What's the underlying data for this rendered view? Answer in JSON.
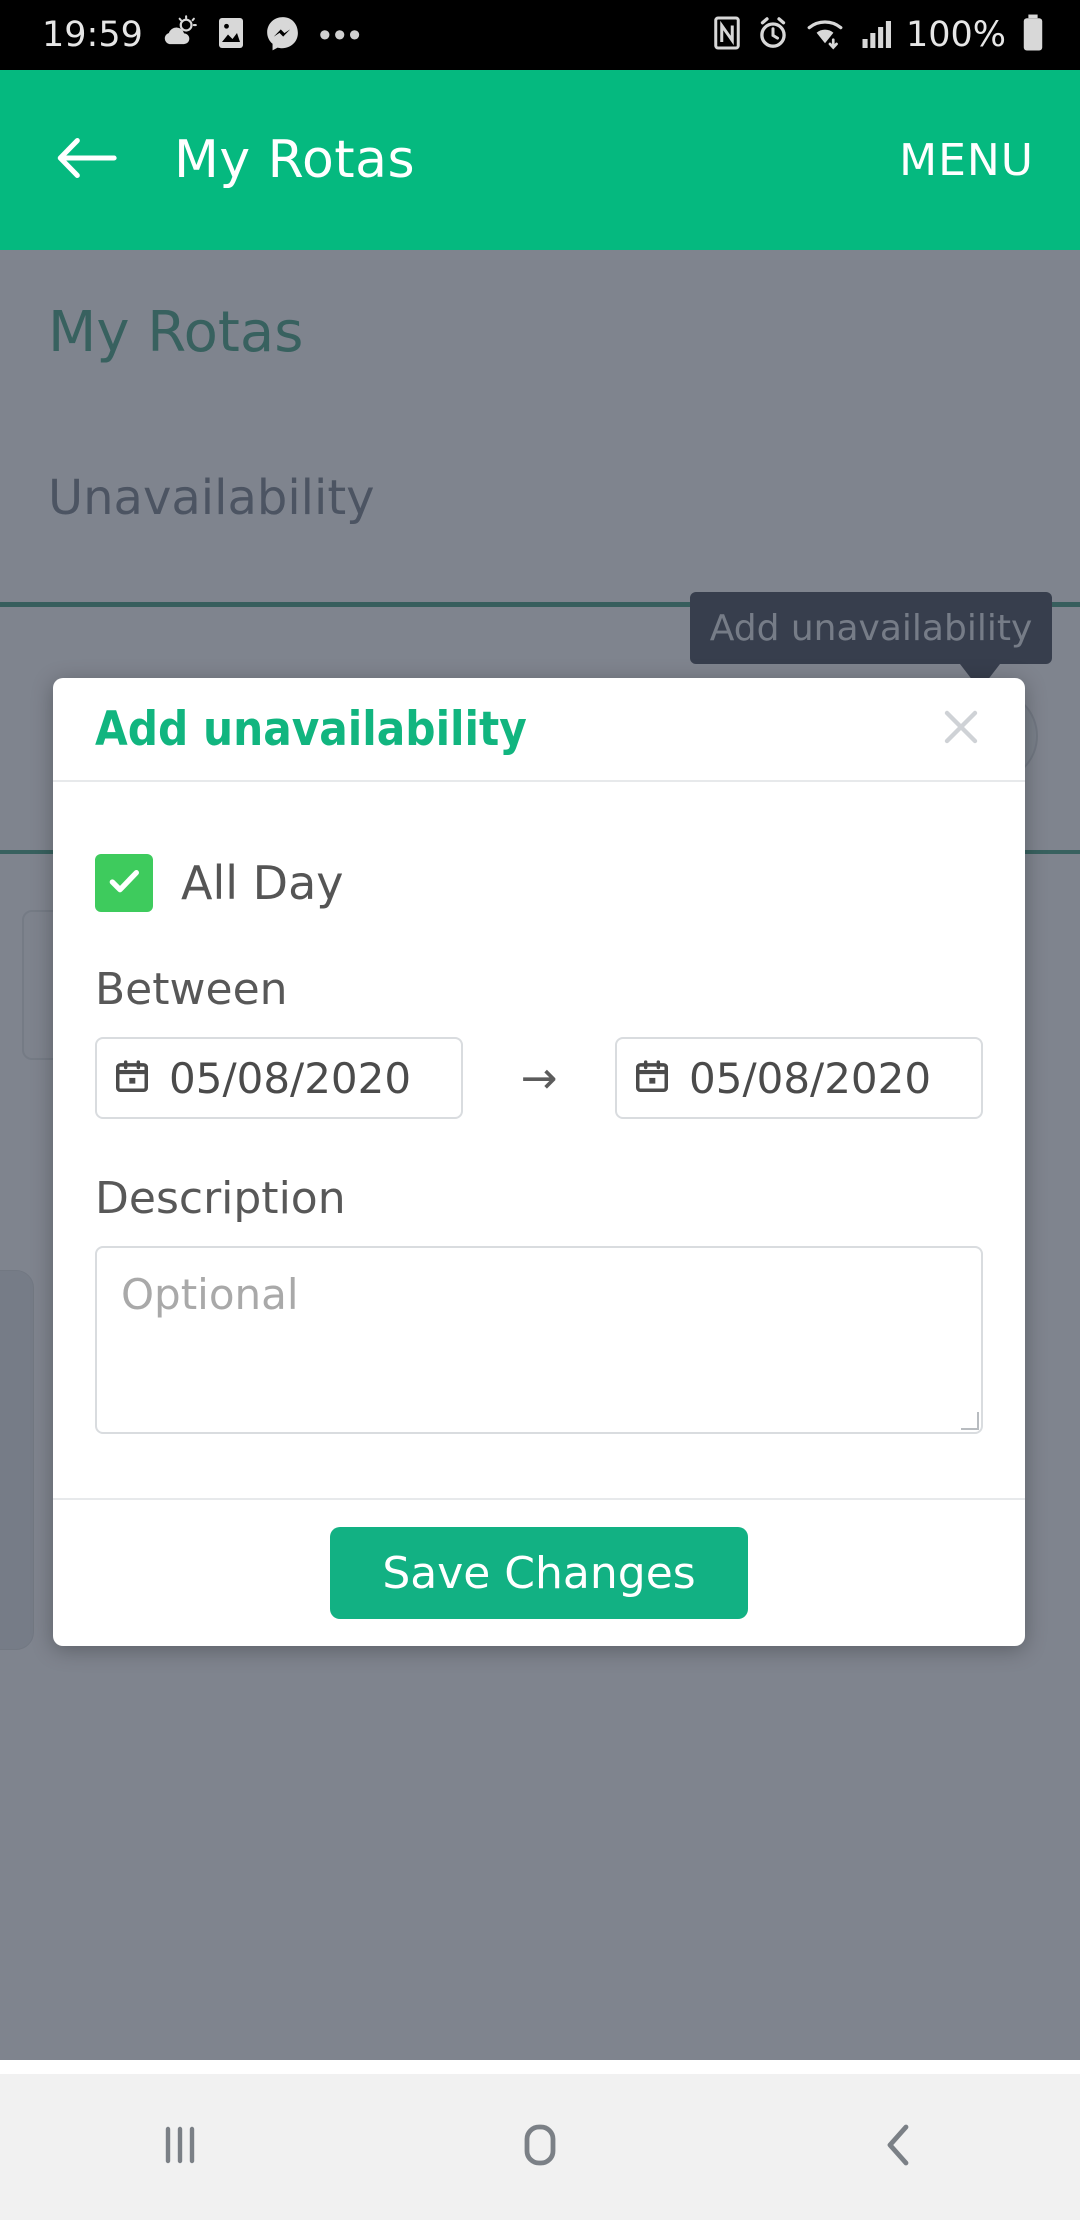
{
  "status_bar": {
    "time": "19:59",
    "battery_percent": "100%",
    "left_icons": [
      "weather-partly-cloudy-icon",
      "gallery-image-icon",
      "messenger-icon",
      "more-notifications-icon"
    ],
    "right_icons": [
      "nfc-icon",
      "alarm-clock-icon",
      "wifi-icon",
      "cellular-signal-icon",
      "battery-full-icon"
    ]
  },
  "app_bar": {
    "back_icon": "arrow-left-icon",
    "title": "My Rotas",
    "menu_label": "MENU",
    "background_color": "#05b97f"
  },
  "page": {
    "heading": "My Rotas",
    "section_heading": "Unavailability",
    "add_button_icon": "plus-circle-icon",
    "tooltip_text": "Add unavailability",
    "tooltip_background": "#0e1726",
    "heading_color": "#128a63"
  },
  "modal": {
    "title": "Add unavailability",
    "title_color": "#11b57f",
    "close_icon": "close-icon",
    "all_day": {
      "label": "All Day",
      "checked": true,
      "check_color": "#3ecb5d",
      "check_icon": "checkmark-icon"
    },
    "between": {
      "label": "Between",
      "start_value": "05/08/2020",
      "end_value": "05/08/2020",
      "separator": "→",
      "calendar_icon": "calendar-icon"
    },
    "description": {
      "label": "Description",
      "value": "",
      "placeholder": "Optional"
    },
    "save_label": "Save Changes",
    "save_color": "#12b183"
  },
  "nav_bar": {
    "recents_icon": "recents-icon",
    "home_icon": "home-icon",
    "back_icon": "back-chevron-icon"
  }
}
